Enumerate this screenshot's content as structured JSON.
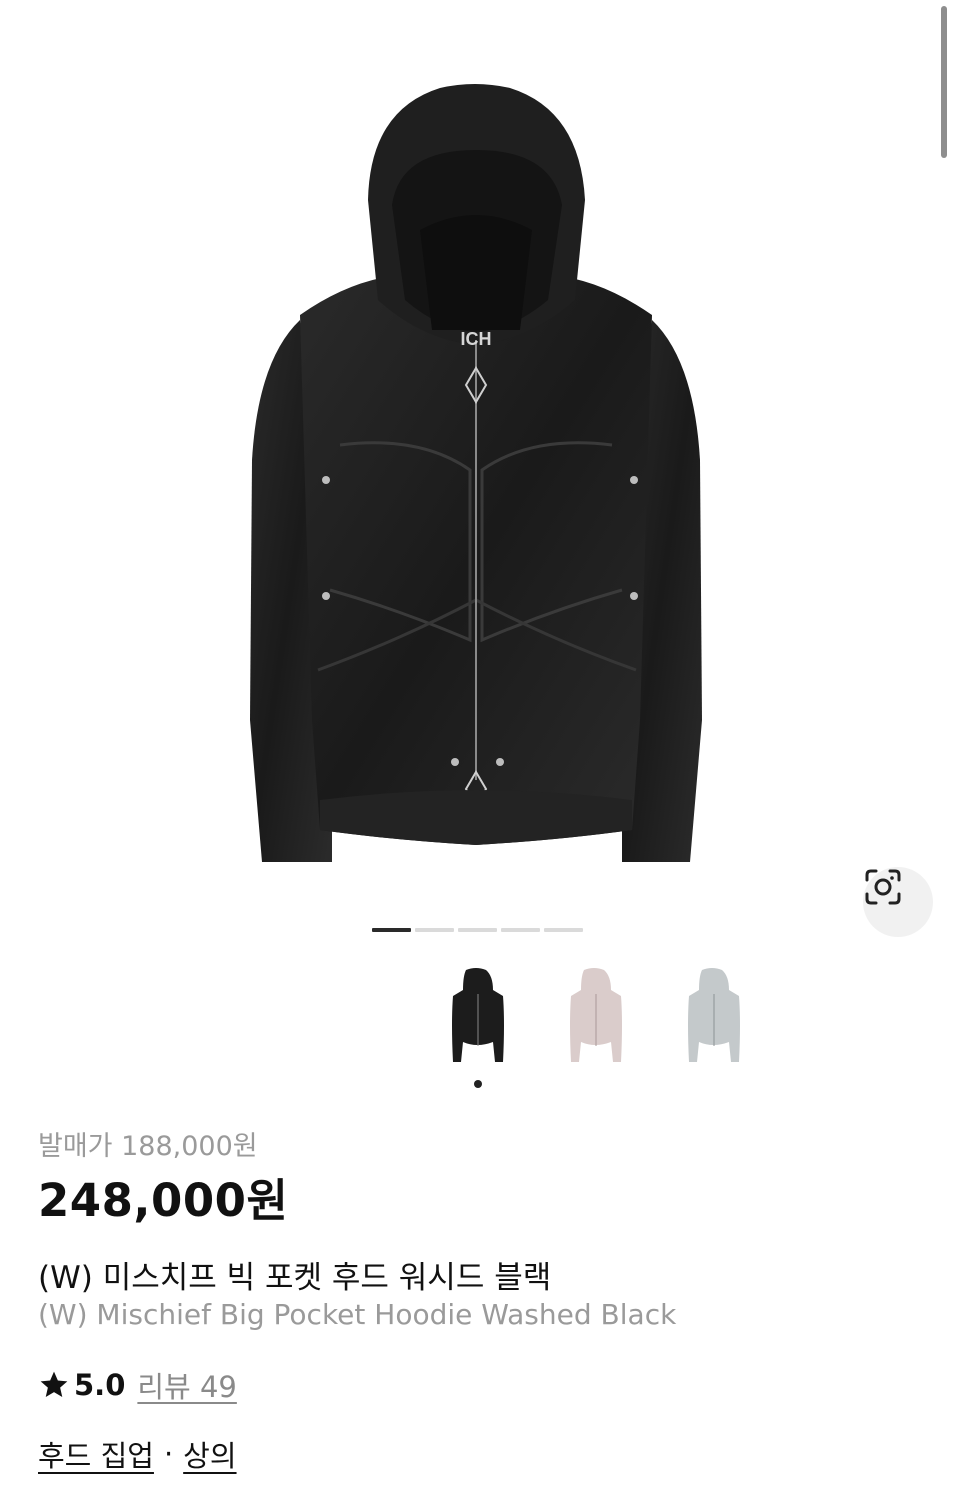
{
  "product": {
    "release_price_label": "발매가 188,000원",
    "price": "248,000원",
    "name_ko": "(W) 미스치프 빅 포켓 후드 워시드 블랙",
    "name_en": "(W) Mischief Big Pocket Hoodie Washed Black",
    "rating": "5.0",
    "reviews_label": "리뷰 49",
    "category_primary": "후드 집업",
    "category_separator": "·",
    "category_secondary": "상의"
  },
  "gallery": {
    "image_count": 5,
    "active_index": 0,
    "hoodie_color": "#1e1e1e"
  },
  "variants": [
    {
      "name": "washed-black",
      "color": "#1c1c1c",
      "selected": true
    },
    {
      "name": "washed-pink",
      "color": "#d9cbc8",
      "selected": false
    },
    {
      "name": "washed-grey",
      "color": "#c3c8ca",
      "selected": false
    }
  ],
  "icons": {
    "lens": "image-search-icon",
    "star": "star-icon"
  },
  "colors": {
    "muted_text": "#9a9a9a",
    "primary_text": "#111111",
    "pager_active": "#2a2a2a",
    "pager_inactive": "#dadada"
  }
}
